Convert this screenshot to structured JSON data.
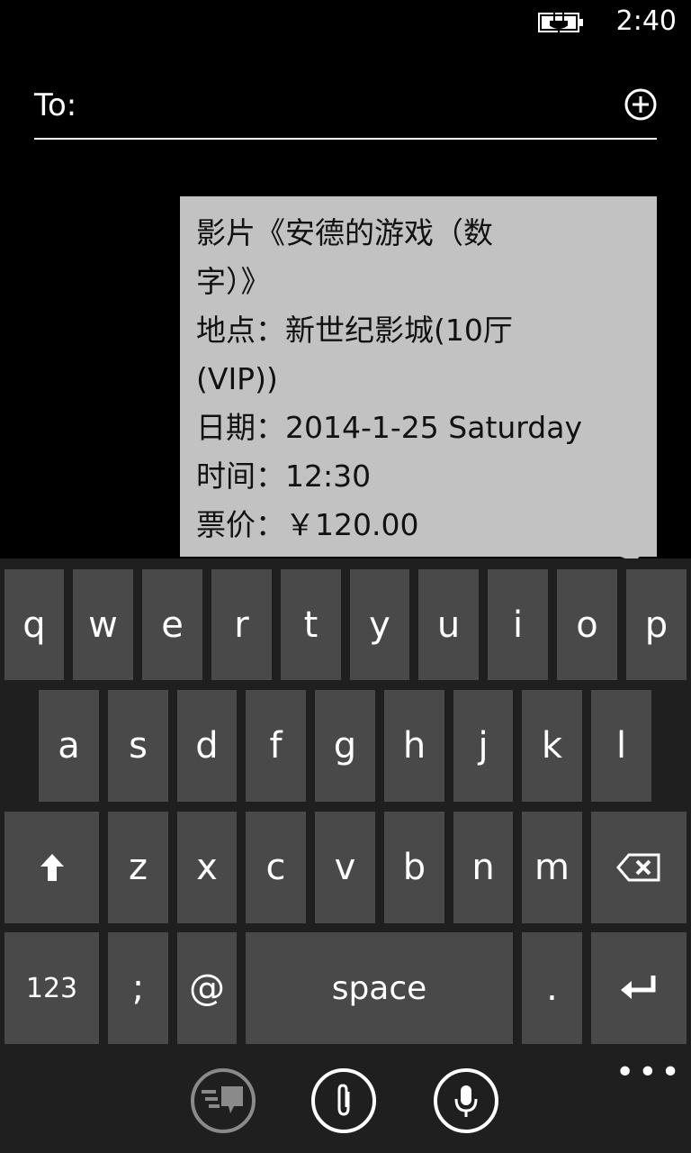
{
  "status_bar": {
    "time": "2:40",
    "battery_icon": "battery-charging-icon"
  },
  "compose": {
    "to_label": "To:",
    "to_value": "",
    "add_icon": "add-circle-icon"
  },
  "message": {
    "lines": [
      "影片《安德的游戏（数",
      "字）》",
      "地点：新世纪影城(10厅",
      "(VIP))",
      "日期：2014-1-25 Saturday",
      "时间：12:30",
      "票价：￥120.00"
    ]
  },
  "keyboard": {
    "row1": [
      "q",
      "w",
      "e",
      "r",
      "t",
      "y",
      "u",
      "i",
      "o",
      "p"
    ],
    "row2": [
      "a",
      "s",
      "d",
      "f",
      "g",
      "h",
      "j",
      "k",
      "l"
    ],
    "row3": [
      "z",
      "x",
      "c",
      "v",
      "b",
      "n",
      "m"
    ],
    "shift_icon": "shift-arrow-icon",
    "backspace_icon": "backspace-icon",
    "numbers_label": "123",
    "semicolon_label": ";",
    "at_label": "@",
    "space_label": "space",
    "period_label": ".",
    "enter_icon": "enter-icon"
  },
  "appbar": {
    "buttons": [
      "send-icon",
      "attach-icon",
      "microphone-icon"
    ],
    "more_label": "•••"
  }
}
